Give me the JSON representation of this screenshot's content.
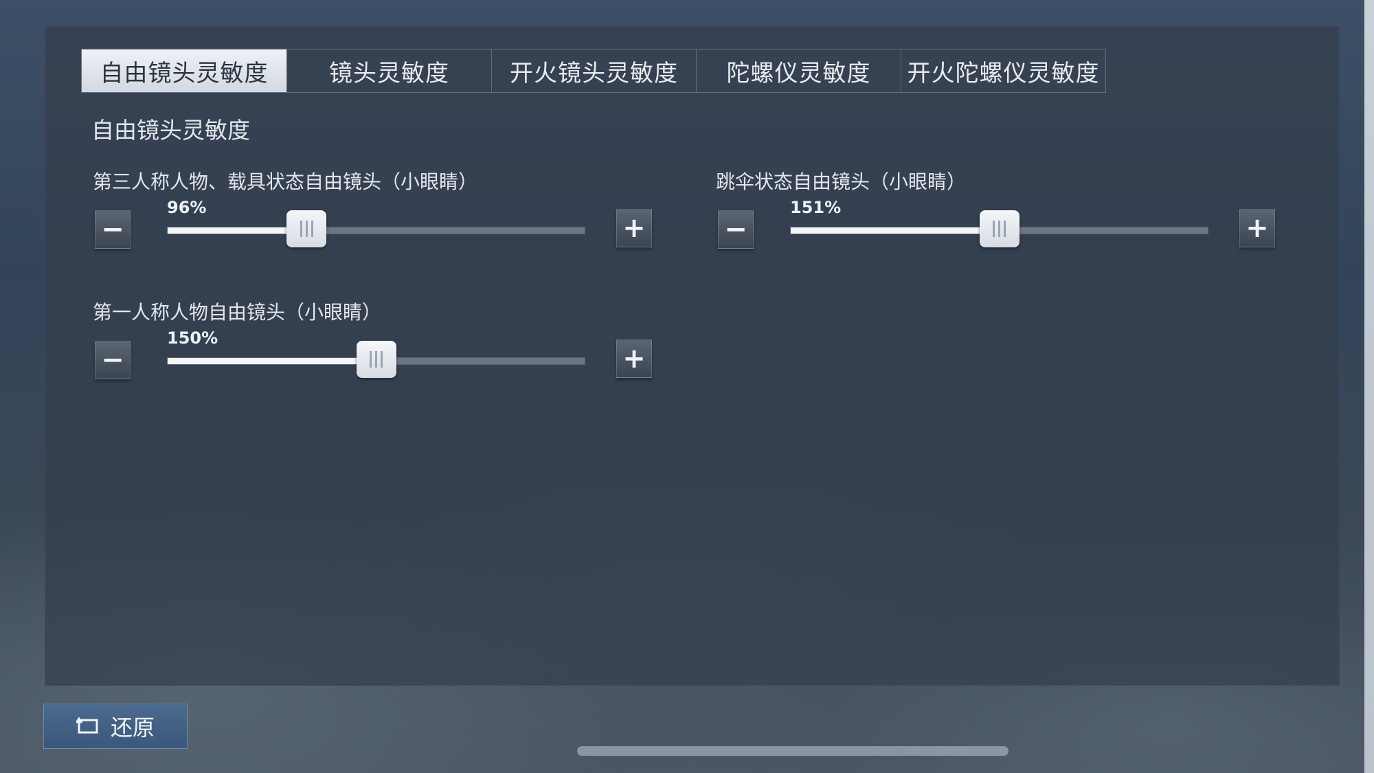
{
  "tabs": [
    {
      "label": "自由镜头灵敏度",
      "active": true
    },
    {
      "label": "镜头灵敏度",
      "active": false
    },
    {
      "label": "开火镜头灵敏度",
      "active": false
    },
    {
      "label": "陀螺仪灵敏度",
      "active": false
    },
    {
      "label": "开火陀螺仪灵敏度",
      "active": false
    }
  ],
  "section": {
    "title": "自由镜头灵敏度"
  },
  "settings": [
    {
      "label": "第三人称人物、载具状态自由镜头（小眼睛）",
      "value_text": "96%",
      "slider_fraction": 0.333
    },
    {
      "label": "跳伞状态自由镜头（小眼睛）",
      "value_text": "151%",
      "slider_fraction": 0.5
    },
    {
      "label": "第一人称人物自由镜头（小眼睛）",
      "value_text": "150%",
      "slider_fraction": 0.5
    }
  ],
  "controls": {
    "minus_symbol": "−",
    "plus_symbol": "+"
  },
  "reset": {
    "label": "还原"
  }
}
